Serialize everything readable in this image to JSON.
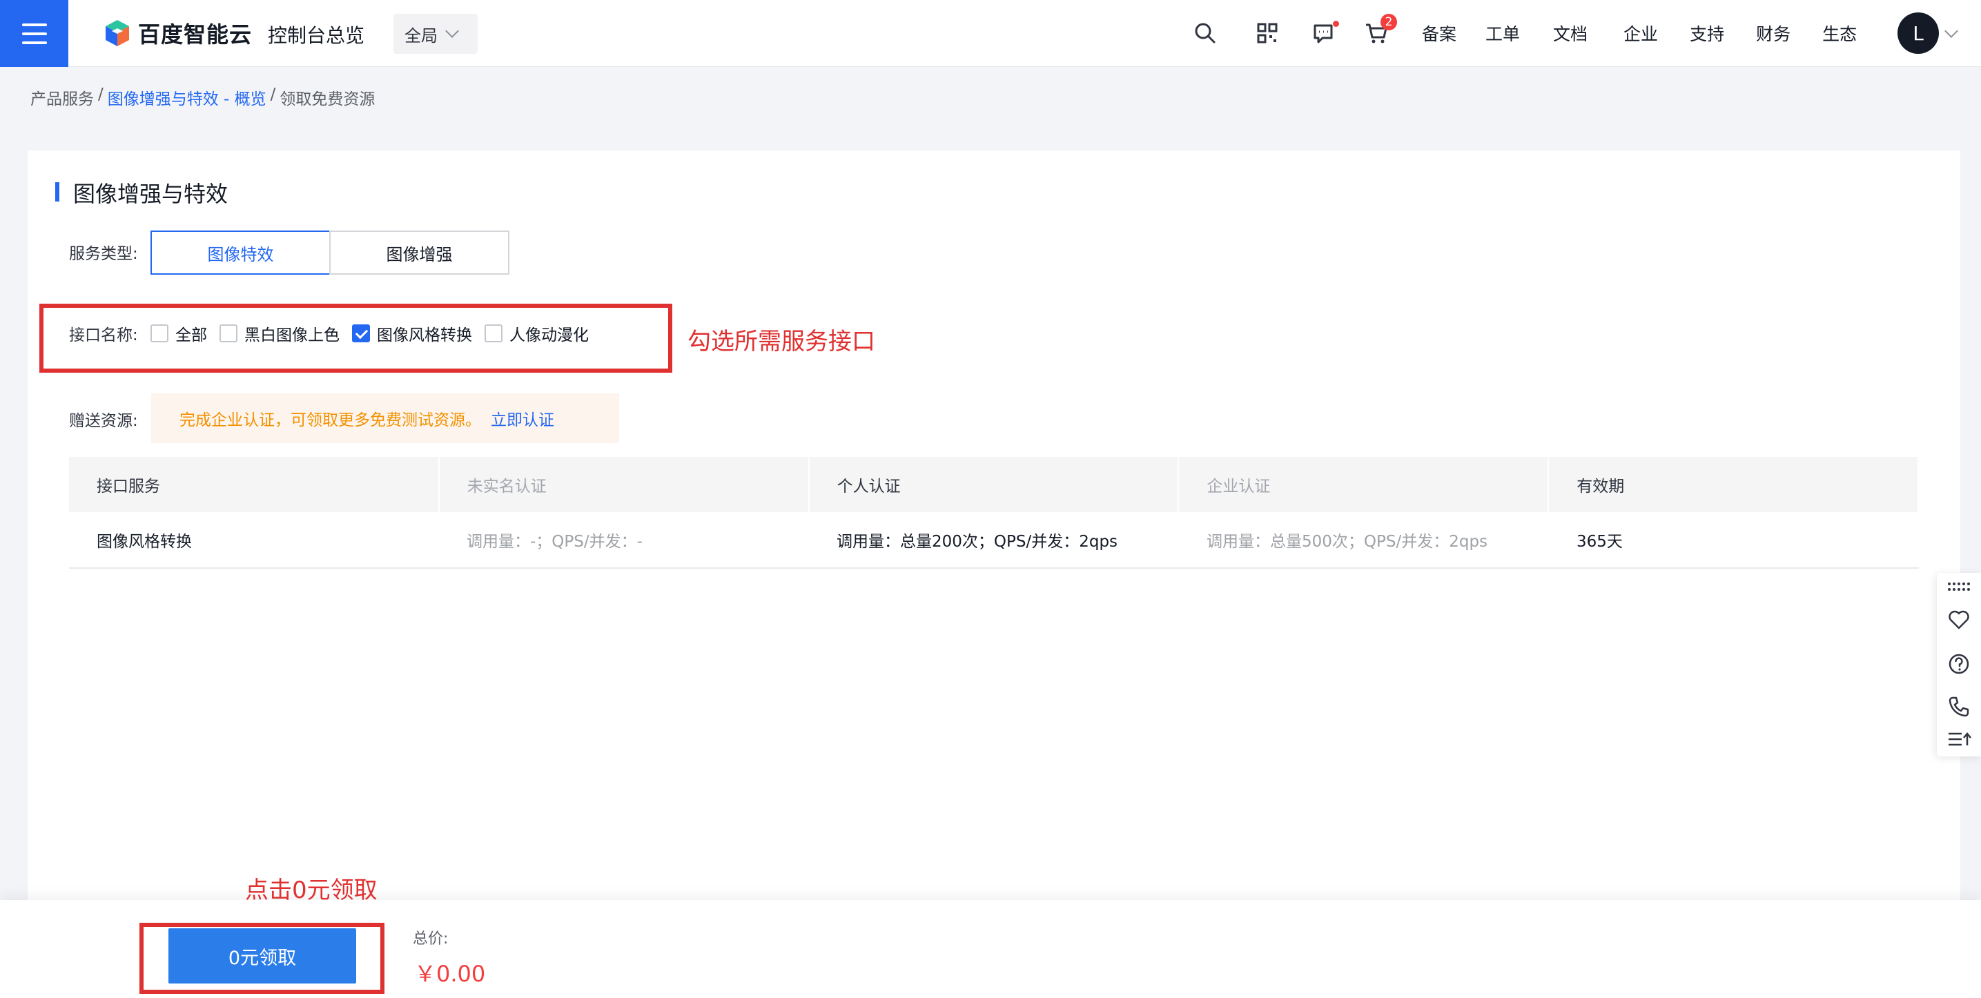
{
  "topbar": {
    "brand": "百度智能云",
    "console_title": "控制台总览",
    "region": "全局",
    "cart_badge": "2",
    "nav": [
      "备案",
      "工单",
      "文档",
      "企业",
      "支持",
      "财务",
      "生态"
    ],
    "avatar_letter": "L",
    "colors": {
      "primary": "#2468f2",
      "badge": "#f33e3e"
    }
  },
  "breadcrumb": {
    "items": [
      "产品服务",
      "图像增强与特效 - 概览",
      "领取免费资源"
    ],
    "separator": "/"
  },
  "page": {
    "title": "图像增强与特效",
    "service_type_label": "服务类型:",
    "service_types": [
      "图像特效",
      "图像增强"
    ],
    "service_type_selected": "图像特效",
    "interface_label": "接口名称:",
    "interfaces": [
      {
        "label": "全部",
        "checked": false
      },
      {
        "label": "黑白图像上色",
        "checked": false
      },
      {
        "label": "图像风格转换",
        "checked": true
      },
      {
        "label": "人像动漫化",
        "checked": false
      }
    ],
    "gift_label": "赠送资源:",
    "notice_text": "完成企业认证，可领取更多免费测试资源。",
    "notice_link": "立即认证"
  },
  "table": {
    "headers": [
      "接口服务",
      "未实名认证",
      "个人认证",
      "企业认证",
      "有效期"
    ],
    "rows": [
      [
        "图像风格转换",
        "调用量：-；QPS/并发：-",
        "调用量：总量200次；QPS/并发：2qps",
        "调用量：总量500次；QPS/并发：2qps",
        "365天"
      ]
    ]
  },
  "annotations": {
    "check_hint": "勾选所需服务接口",
    "claim_hint": "点击0元领取",
    "color": "#e03131"
  },
  "footer": {
    "claim_button": "0元领取",
    "total_label": "总价:",
    "total_value": "￥0.00"
  }
}
